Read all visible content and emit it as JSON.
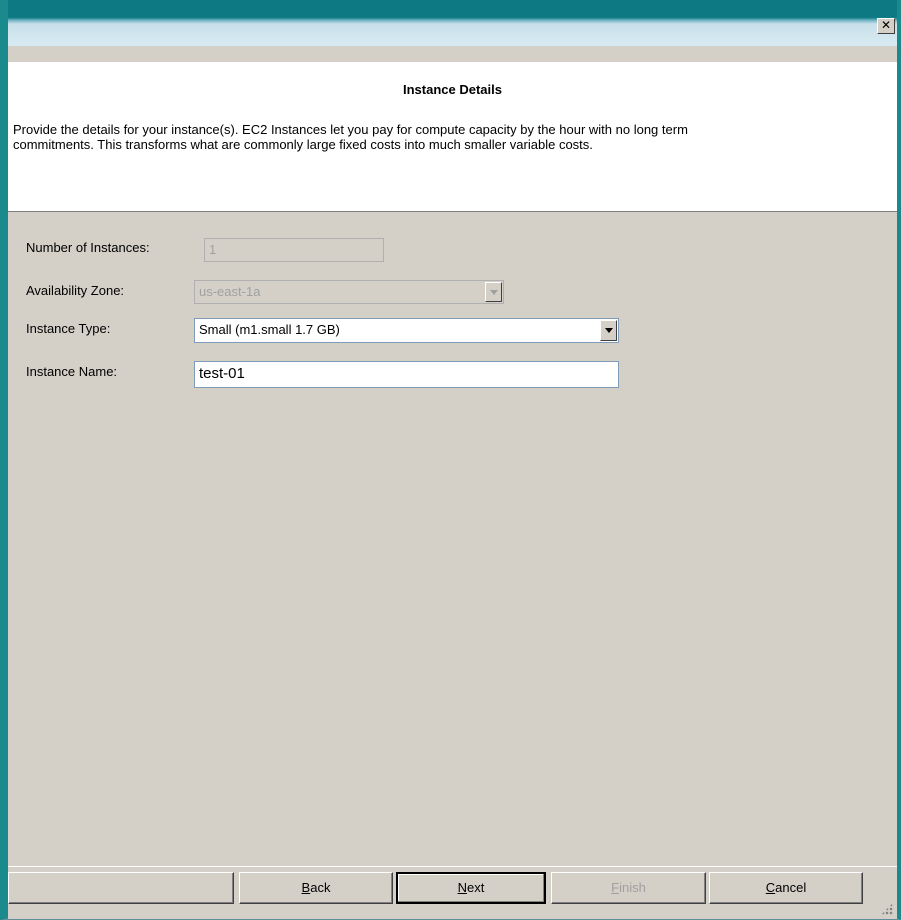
{
  "window": {
    "close_glyph": "✕"
  },
  "header": {
    "title": "Instance Details",
    "description_line1": "Provide the details for your instance(s). EC2 Instances let you pay for compute capacity by the hour with no long term",
    "description_line2": "commitments. This transforms what are commonly large fixed costs into much smaller variable costs."
  },
  "form": {
    "num_instances_label": "Number of Instances:",
    "num_instances_value": "1",
    "availability_zone_label": "Availability Zone:",
    "availability_zone_value": "us-east-1a",
    "instance_type_label": "Instance Type:",
    "instance_type_value": "Small (m1.small 1.7 GB)",
    "instance_name_label": "Instance Name:",
    "instance_name_value": "test-01"
  },
  "buttons": {
    "back": {
      "mnemonic": "B",
      "rest": "ack"
    },
    "next": {
      "mnemonic": "N",
      "rest": "ext"
    },
    "finish": {
      "mnemonic": "F",
      "rest": "inish"
    },
    "cancel": {
      "mnemonic": "C",
      "rest": "ancel"
    }
  },
  "colors": {
    "title_bar": "#0d7a83",
    "dialog_face": "#d4d0c8"
  }
}
